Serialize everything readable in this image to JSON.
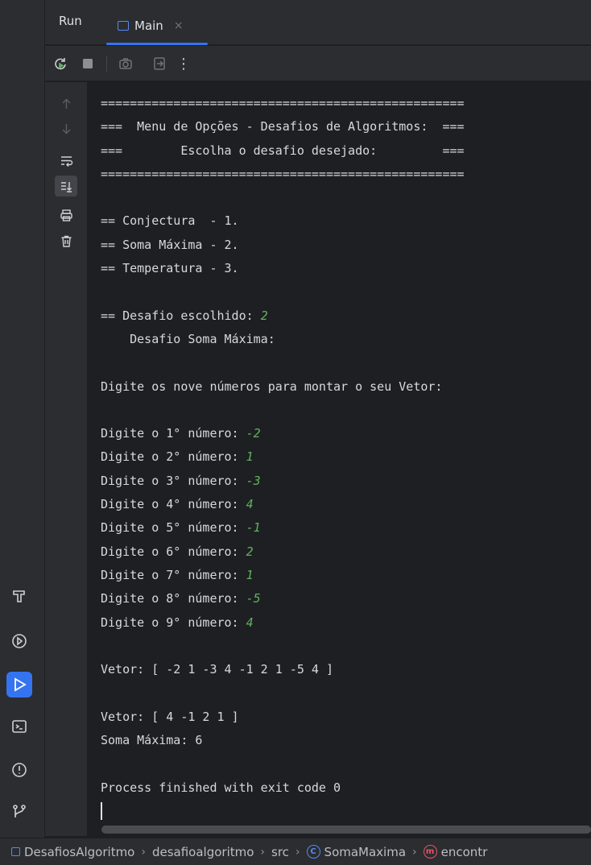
{
  "run_window": {
    "title": "Run",
    "tab": {
      "label": "Main",
      "close": "×"
    }
  },
  "toolbar": {
    "rerun_icon": "rerun-icon",
    "stop_icon": "stop-icon",
    "screenshot_icon": "camera-icon",
    "exit_icon": "exit-icon",
    "more_label": "⋮"
  },
  "console": {
    "lines": [
      {
        "text": "=================================================="
      },
      {
        "text": "===  Menu de Opções - Desafios de Algoritmos:  ==="
      },
      {
        "text": "===        Escolha o desafio desejado:         ==="
      },
      {
        "text": "=================================================="
      },
      {
        "text": ""
      },
      {
        "text": "== Conjectura  - 1."
      },
      {
        "text": "== Soma Máxima - 2."
      },
      {
        "text": "== Temperatura - 3."
      },
      {
        "text": ""
      },
      {
        "text": "== Desafio escolhido: ",
        "input": "2"
      },
      {
        "text": "    Desafio Soma Máxima:"
      },
      {
        "text": ""
      },
      {
        "text": "Digite os nove números para montar o seu Vetor:"
      },
      {
        "text": ""
      },
      {
        "text": "Digite o 1° número: ",
        "input": "-2"
      },
      {
        "text": "Digite o 2° número: ",
        "input": "1"
      },
      {
        "text": "Digite o 3° número: ",
        "input": "-3"
      },
      {
        "text": "Digite o 4° número: ",
        "input": "4"
      },
      {
        "text": "Digite o 5° número: ",
        "input": "-1"
      },
      {
        "text": "Digite o 6° número: ",
        "input": "2"
      },
      {
        "text": "Digite o 7° número: ",
        "input": "1"
      },
      {
        "text": "Digite o 8° número: ",
        "input": "-5"
      },
      {
        "text": "Digite o 9° número: ",
        "input": "4"
      },
      {
        "text": ""
      },
      {
        "text": "Vetor: [ -2 1 -3 4 -1 2 1 -5 4 ]"
      },
      {
        "text": ""
      },
      {
        "text": "Vetor: [ 4 -1 2 1 ]"
      },
      {
        "text": "Soma Máxima: 6"
      },
      {
        "text": ""
      },
      {
        "text": "Process finished with exit code 0"
      }
    ]
  },
  "breadcrumbs": {
    "project": "DesafiosAlgoritmo",
    "package": "desafioalgoritmo",
    "folder": "src",
    "class": "SomaMaxima",
    "method": "encontr",
    "class_icon_letter": "C",
    "method_icon_letter": "m",
    "separator": "›"
  },
  "colors": {
    "accent": "#3574f0",
    "input_text": "#5fb25f",
    "background": "#1e1f22",
    "panel": "#2b2d30"
  }
}
